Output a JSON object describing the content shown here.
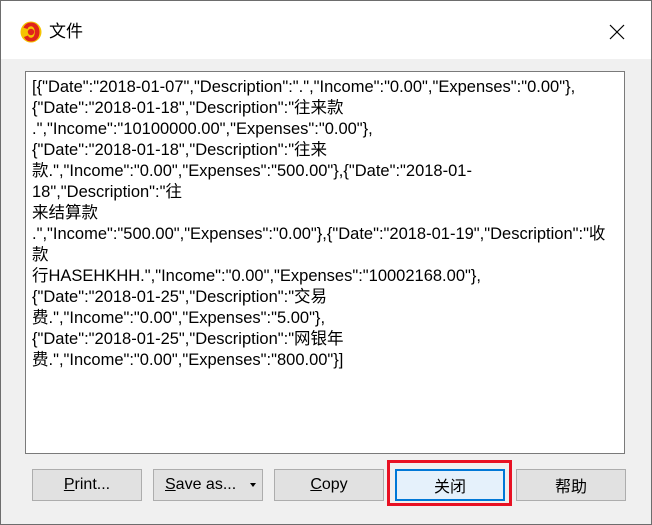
{
  "window": {
    "title": "文件",
    "close_glyph": "✕"
  },
  "content": {
    "text": "[{\"Date\":\"2018-01-07\",\"Description\":\".\",\"Income\":\"0.00\",\"Expenses\":\"0.00\"},\n{\"Date\":\"2018-01-18\",\"Description\":\"往来款\n.\",\"Income\":\"10100000.00\",\"Expenses\":\"0.00\"},\n{\"Date\":\"2018-01-18\",\"Description\":\"往来\n款.\",\"Income\":\"0.00\",\"Expenses\":\"500.00\"},{\"Date\":\"2018-01-18\",\"Description\":\"往\n来结算款\n.\",\"Income\":\"500.00\",\"Expenses\":\"0.00\"},{\"Date\":\"2018-01-19\",\"Description\":\"收款\n行HASEHKHH.\",\"Income\":\"0.00\",\"Expenses\":\"10002168.00\"},\n{\"Date\":\"2018-01-25\",\"Description\":\"交易费.\",\"Income\":\"0.00\",\"Expenses\":\"5.00\"},\n{\"Date\":\"2018-01-25\",\"Description\":\"网银年\n费.\",\"Income\":\"0.00\",\"Expenses\":\"800.00\"}]"
  },
  "buttons": {
    "print_ul": "P",
    "print_rest": "rint...",
    "saveas_ul": "S",
    "saveas_rest": "ave as...",
    "copy_ul": "C",
    "copy_rest": "opy",
    "close": "关闭",
    "help": "帮助"
  },
  "icons": {
    "app": "app-logo-icon",
    "close": "close-icon",
    "dropdown": "chevron-down-icon"
  },
  "colors": {
    "highlight_border": "#e81123",
    "default_button_border": "#0078d7",
    "app_icon_red": "#e0241b",
    "app_icon_yellow": "#f5c400"
  }
}
